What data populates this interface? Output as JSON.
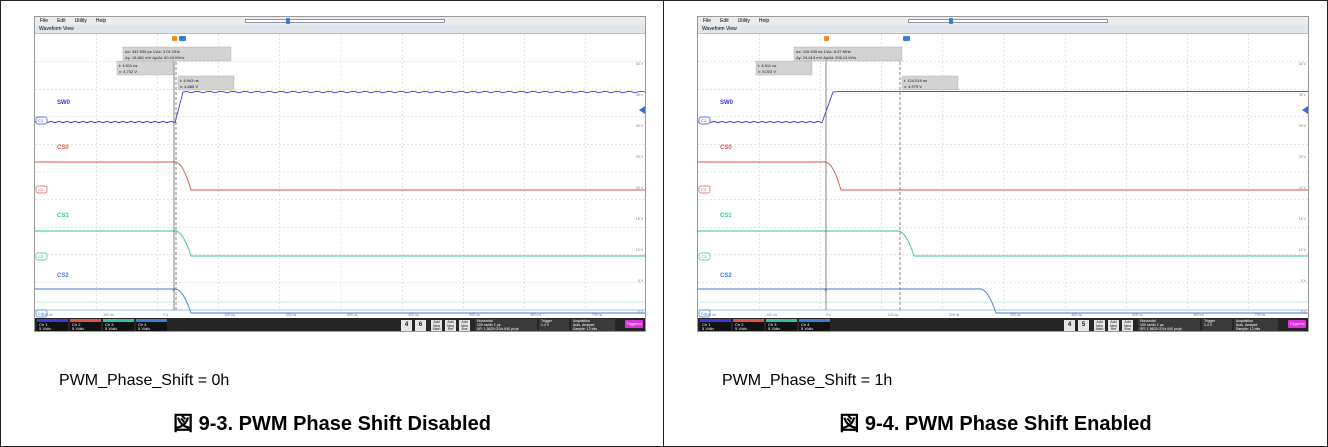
{
  "colors": {
    "ch1": "#3a3ad6",
    "ch2": "#d9534f",
    "ch3": "#32c2a2",
    "ch4": "#3a7fd5",
    "trigger_badge": "#e02fe0"
  },
  "icons": [
    "position-arrow-icon",
    "trigger-marker-icon",
    "cursor-marker-icon"
  ],
  "panels": [
    {
      "caption": "PWM_Phase_Shift = 0h",
      "figure_title": "図 9-3. PWM Phase Shift Disabled",
      "scope": {
        "menu": [
          "File",
          "Edit",
          "Utility",
          "Help"
        ],
        "window_title": "Waveform View",
        "readout_top": [
          "Δx: 331.930 ps   1/Δx: 3.01 GHz",
          "Δy: 16.661 mV   Δy/Δt: 50.19 MV/s"
        ],
        "cursor_a": [
          "t: 4.611 ns",
          "v: 4.702 V"
        ],
        "cursor_b": [
          "t: 4.943 ns",
          "v: 4.685 V"
        ],
        "trace_labels": [
          "SW0",
          "CS0",
          "CS1",
          "CS2"
        ],
        "channel_markers": [
          "C1",
          "C2",
          "C3",
          "C4"
        ],
        "right_scale": [
          "40 V",
          "35 V",
          "30 V",
          "25 V",
          "20 V",
          "15 V",
          "10 V",
          "5 V",
          "0 V"
        ],
        "time_ticks": [
          "-200 ns",
          "-100 ns",
          "0 s",
          "100 ns",
          "200 ns",
          "300 ns",
          "400 ns",
          "500 ns",
          "600 ns",
          "700 ns"
        ],
        "channels": [
          {
            "name": "Ch 1",
            "l1": "5 V/div",
            "l2": "1MΩ",
            "l3": "20 MHz"
          },
          {
            "name": "Ch 2",
            "l1": "5 V/div",
            "l2": "1MΩ",
            "l3": "20 MHz"
          },
          {
            "name": "Ch 3",
            "l1": "5 V/div",
            "l2": "1MΩ",
            "l3": "20 MHz"
          },
          {
            "name": "Ch 4",
            "l1": "5 V/div",
            "l2": "1MΩ",
            "l3": "20 MHz"
          }
        ],
        "buttons": [
          "4",
          "6",
          "Add New Math",
          "Add New Ref",
          "Add New Bus"
        ],
        "horizontal": [
          "Horizontal",
          "100 ns/div   1 µs",
          "SR: 1.5625 GS/s 640 ps/pt",
          "RL: 1.563 kpts   21.7%"
        ],
        "trigger": [
          "Trigger",
          "1.4 V"
        ],
        "acquisition": [
          "Acquisition",
          "Auto,   Analyze",
          "Sample: 12 bits",
          "637 Acqs"
        ],
        "status": "Triggered"
      }
    },
    {
      "caption": "PWM_Phase_Shift = 1h",
      "figure_title": "図 9-4. PWM Phase Shift Enabled",
      "scope": {
        "menu": [
          "File",
          "Edit",
          "Utility",
          "Help"
        ],
        "window_title": "Waveform View",
        "readout_top": [
          "Δx: 119.405 ns   1/Δx: 8.37 MHz",
          "Δy: 24.613 mV   Δy/Δt: 206.13 kV/s"
        ],
        "cursor_a": [
          "t: 4.611 ns",
          "v: 5.003 V"
        ],
        "cursor_b": [
          "t: 124.016 ns",
          "v: 4.979 V"
        ],
        "trace_labels": [
          "SW0",
          "CS0",
          "CS1",
          "CS2"
        ],
        "channel_markers": [
          "C1",
          "C2",
          "C3",
          "C4"
        ],
        "right_scale": [
          "40 V",
          "35 V",
          "30 V",
          "25 V",
          "20 V",
          "15 V",
          "10 V",
          "5 V",
          "0 V"
        ],
        "time_ticks": [
          "-200 ns",
          "-100 ns",
          "0 s",
          "100 ns",
          "200 ns",
          "300 ns",
          "400 ns",
          "500 ns",
          "600 ns",
          "700 ns"
        ],
        "channels": [
          {
            "name": "Ch 1",
            "l1": "5 V/div",
            "l2": "1MΩ",
            "l3": "20 MHz"
          },
          {
            "name": "Ch 2",
            "l1": "5 V/div",
            "l2": "1MΩ",
            "l3": "20 MHz"
          },
          {
            "name": "Ch 3",
            "l1": "5 V/div",
            "l2": "1MΩ",
            "l3": "20 MHz"
          },
          {
            "name": "Ch 4",
            "l1": "5 V/div",
            "l2": "1MΩ",
            "l3": "20 MHz"
          }
        ],
        "buttons": [
          "4",
          "5",
          "Add New Math",
          "Add New Ref",
          "Add New Bus"
        ],
        "horizontal": [
          "Horizontal",
          "100 ns/div   1 µs",
          "SR: 1.5625 GS/s 640 ps/pt",
          "RL: 1.563 kpts   21.7%"
        ],
        "trigger": [
          "Trigger",
          "1.4 V"
        ],
        "acquisition": [
          "Acquisition",
          "Auto,   Analyze",
          "Sample: 12 bits",
          "2.480 kAcqs"
        ],
        "status": "Triggered"
      }
    }
  ]
}
